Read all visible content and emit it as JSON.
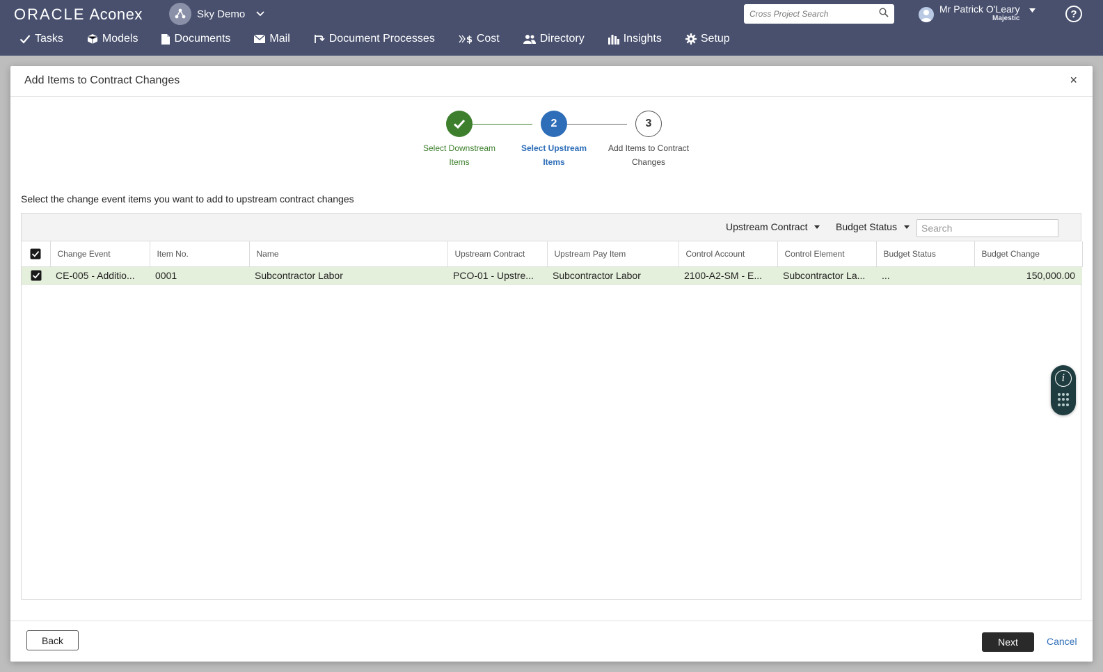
{
  "app": {
    "brand_oracle": "ORACLE",
    "brand_aconex": "Aconex",
    "project_name": "Sky Demo",
    "search_placeholder": "Cross Project Search",
    "user_name": "Mr Patrick O'Leary",
    "user_org": "Majestic",
    "help_glyph": "?"
  },
  "nav": {
    "items": [
      {
        "label": "Tasks",
        "icon": "check-icon"
      },
      {
        "label": "Models",
        "icon": "cube-icon"
      },
      {
        "label": "Documents",
        "icon": "document-icon"
      },
      {
        "label": "Mail",
        "icon": "envelope-icon"
      },
      {
        "label": "Document Processes",
        "icon": "workflow-icon"
      },
      {
        "label": "Cost",
        "icon": "cost-icon"
      },
      {
        "label": "Directory",
        "icon": "people-icon"
      },
      {
        "label": "Insights",
        "icon": "bar-chart-icon"
      },
      {
        "label": "Setup",
        "icon": "gear-icon"
      }
    ]
  },
  "modal": {
    "title": "Add Items to Contract Changes",
    "close_glyph": "×",
    "steps": [
      {
        "number": "1",
        "line1": "Select Downstream",
        "line2": "Items",
        "state": "done"
      },
      {
        "number": "2",
        "line1": "Select Upstream",
        "line2": "Items",
        "state": "active"
      },
      {
        "number": "3",
        "line1": "Add Items to Contract",
        "line2": "Changes",
        "state": "todo"
      }
    ],
    "instruction": "Select the change event items you want to add to upstream contract changes",
    "filters": {
      "upstream_contract": "Upstream Contract",
      "budget_status": "Budget Status",
      "search_placeholder": "Search"
    },
    "table": {
      "columns": [
        "Change Event",
        "Item No.",
        "Name",
        "Upstream Contract",
        "Upstream Pay Item",
        "Control Account",
        "Control Element",
        "Budget Status",
        "Budget Change"
      ],
      "rows": [
        {
          "selected": true,
          "change_event": "CE-005 - Additio...",
          "item_no": "0001",
          "name": "Subcontractor Labor",
          "upstream_contract": "PCO-01 - Upstre...",
          "upstream_pay_item": "Subcontractor Labor",
          "control_account": "2100-A2-SM - E...",
          "control_element": "Subcontractor La...",
          "budget_status": "...",
          "budget_change": "150,000.00"
        }
      ]
    },
    "buttons": {
      "back": "Back",
      "next": "Next",
      "cancel": "Cancel"
    }
  },
  "colors": {
    "header_bg": "#48506e",
    "step_done": "#3d7f2c",
    "step_active": "#2e6eb8",
    "row_selected": "#e5f0dc"
  }
}
